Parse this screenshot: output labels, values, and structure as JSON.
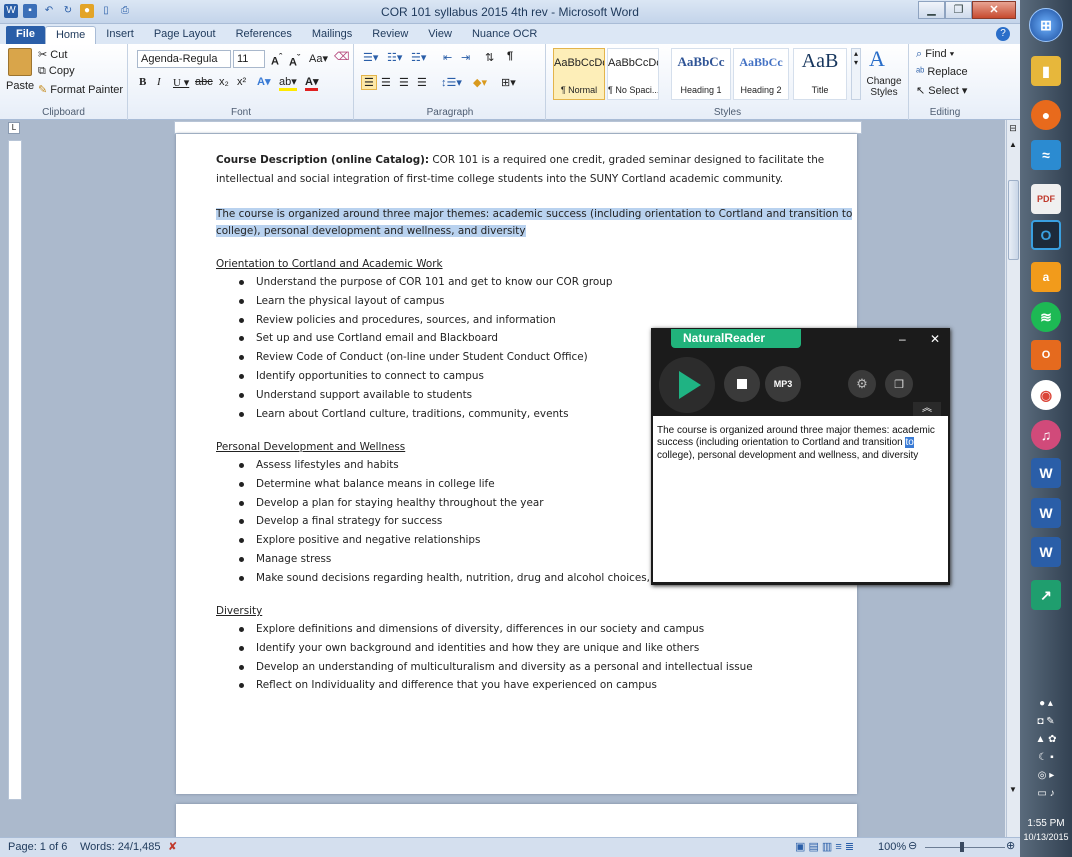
{
  "window": {
    "title": "COR 101 syllabus 2015 4th rev - Microsoft Word"
  },
  "tabs": [
    "File",
    "Home",
    "Insert",
    "Page Layout",
    "References",
    "Mailings",
    "Review",
    "View",
    "Nuance OCR"
  ],
  "clipboard": {
    "paste": "Paste",
    "cut": "Cut",
    "copy": "Copy",
    "format_painter": "Format Painter",
    "label": "Clipboard"
  },
  "font": {
    "name": "Agenda-Regula",
    "size": "11",
    "label": "Font"
  },
  "paragraph": {
    "label": "Paragraph"
  },
  "styles": {
    "items": [
      {
        "sample": "AaBbCcDc",
        "name": "¶ Normal"
      },
      {
        "sample": "AaBbCcDc",
        "name": "¶ No Spaci..."
      },
      {
        "sample": "AaBbCc",
        "name": "Heading 1"
      },
      {
        "sample": "AaBbCc",
        "name": "Heading 2"
      },
      {
        "sample": "AaB",
        "name": "Title"
      }
    ],
    "change_styles": "Change Styles",
    "label": "Styles"
  },
  "editing": {
    "find": "Find",
    "replace": "Replace",
    "select": "Select",
    "label": "Editing"
  },
  "document": {
    "desc_bold": "Course Description (online Catalog):",
    "desc_line1": " COR 101 is a required one credit, graded seminar designed to facilitate the",
    "desc_line2": "intellectual and social integration of first-time college students into the SUNY Cortland academic community.",
    "sel_line1": "The course is organized around three major themes: academic success (including orientation to Cortland and transition to",
    "sel_line2": "college), personal development and wellness, and diversity",
    "sections": [
      {
        "heading": "Orientation to Cortland and Academic Work",
        "items": [
          "Understand the purpose of COR 101 and get to know our COR group",
          "Learn the physical layout of campus",
          "Review policies and procedures, sources, and information",
          "Set up and use Cortland email and Blackboard",
          "Review Code of Conduct (on-line under Student Conduct Office)",
          "Identify opportunities to connect to campus",
          "Understand support available to students",
          "Learn about Cortland culture, traditions, community, events"
        ]
      },
      {
        "heading": "Personal Development and Wellness",
        "items": [
          "Assess lifestyles and habits",
          "Determine what balance means in college life",
          "Develop a plan for staying healthy throughout the year",
          "Develop a final strategy for success",
          "Explore positive and negative relationships",
          "Manage stress",
          "Make sound decisions regarding health, nutrition, drug and alcohol choices, and"
        ]
      },
      {
        "heading": "Diversity",
        "items": [
          "Explore definitions and dimensions of diversity, differences in our society and campus",
          "Identify your own background and identities and how they are unique and like others",
          "Develop an understanding of multiculturalism and diversity as a personal and intellectual issue",
          "Reflect on Individuality and difference that you have experienced on campus"
        ]
      }
    ]
  },
  "natural_reader": {
    "title": "NaturalReader",
    "mp3": "MP3",
    "text_before": "The course is organized around three major themes: academic success (including orientation to Cortland and transition ",
    "text_highlight": "to",
    "text_after": " college), personal development and wellness, and diversity"
  },
  "status": {
    "page": "Page: 1 of 6",
    "words": "Words: 24/1,485",
    "zoom": "100%"
  },
  "clock": {
    "time": "1:55 PM",
    "date": "10/13/2015"
  }
}
